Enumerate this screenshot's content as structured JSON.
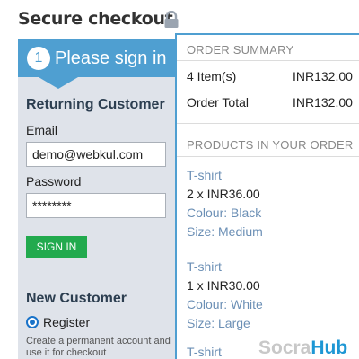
{
  "header": {
    "title": "Secure checkout",
    "lock_icon": "lock-icon"
  },
  "login": {
    "step_number": "1",
    "step_title": "Please sign in",
    "returning_title": "Returning Customer",
    "email_label": "Email",
    "email_value": "demo@webkul.com",
    "password_label": "Password",
    "password_value": "********",
    "signin_label": "SIGN IN",
    "new_customer_title": "New Customer",
    "register_label": "Register",
    "register_helper": "Create a permanent account and use it for checkout"
  },
  "summary": {
    "heading": "ORDER SUMMARY",
    "items_label": "4 Item(s)",
    "items_value": "INR132.00",
    "total_label": "Order Total",
    "total_value": "INR132.00",
    "products_heading": "PRODUCTS IN YOUR ORDER",
    "products": [
      {
        "name": "T-shirt",
        "qty_price": "2 x INR36.00",
        "colour": "Colour: Black",
        "size": "Size: Medium"
      },
      {
        "name": "T-shirt",
        "qty_price": "1 x INR30.00",
        "colour": "Colour: White",
        "size": "Size: Large"
      },
      {
        "name": "T-shirt"
      }
    ]
  },
  "watermark": {
    "part1": "Socra",
    "part2": "Hub"
  },
  "colors": {
    "accent_blue": "#4f9fd1",
    "signin_green": "#22aa4e",
    "link_blue": "#6b8fb5",
    "panel_bg": "#dfe3ea"
  }
}
